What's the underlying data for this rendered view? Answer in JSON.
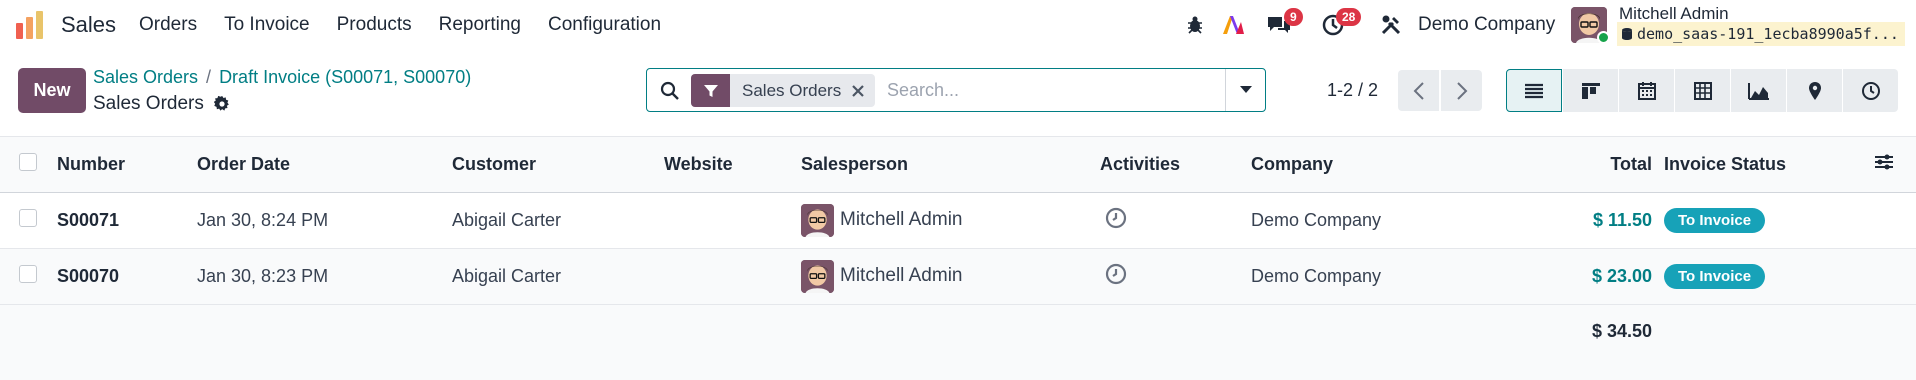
{
  "navbar": {
    "app_name": "Sales",
    "menu": [
      "Orders",
      "To Invoice",
      "Products",
      "Reporting",
      "Configuration"
    ],
    "messages_count": "9",
    "activities_count": "28",
    "company": "Demo Company",
    "user_name": "Mitchell Admin",
    "database": "demo_saas-191_1ecba8990a5f..."
  },
  "control": {
    "new_label": "New",
    "breadcrumb": [
      "Sales Orders",
      "Draft Invoice (S00071, S00070)"
    ],
    "subtitle": "Sales Orders",
    "facet_label": "Sales Orders",
    "search_placeholder": "Search...",
    "pager": "1-2 / 2"
  },
  "table": {
    "headers": [
      "Number",
      "Order Date",
      "Customer",
      "Website",
      "Salesperson",
      "Activities",
      "Company",
      "Total",
      "Invoice Status"
    ],
    "rows": [
      {
        "number": "S00071",
        "date": "Jan 30, 8:24 PM",
        "customer": "Abigail Carter",
        "website": "",
        "salesperson": "Mitchell Admin",
        "company": "Demo Company",
        "total": "$ 11.50",
        "status": "To Invoice"
      },
      {
        "number": "S00070",
        "date": "Jan 30, 8:23 PM",
        "customer": "Abigail Carter",
        "website": "",
        "salesperson": "Mitchell Admin",
        "company": "Demo Company",
        "total": "$ 23.00",
        "status": "To Invoice"
      }
    ],
    "sum_total": "$ 34.50"
  },
  "colors": {
    "brand": "#714b67",
    "accent": "#017e84",
    "status_pill": "#17a2b8",
    "badge": "#dc3545"
  }
}
